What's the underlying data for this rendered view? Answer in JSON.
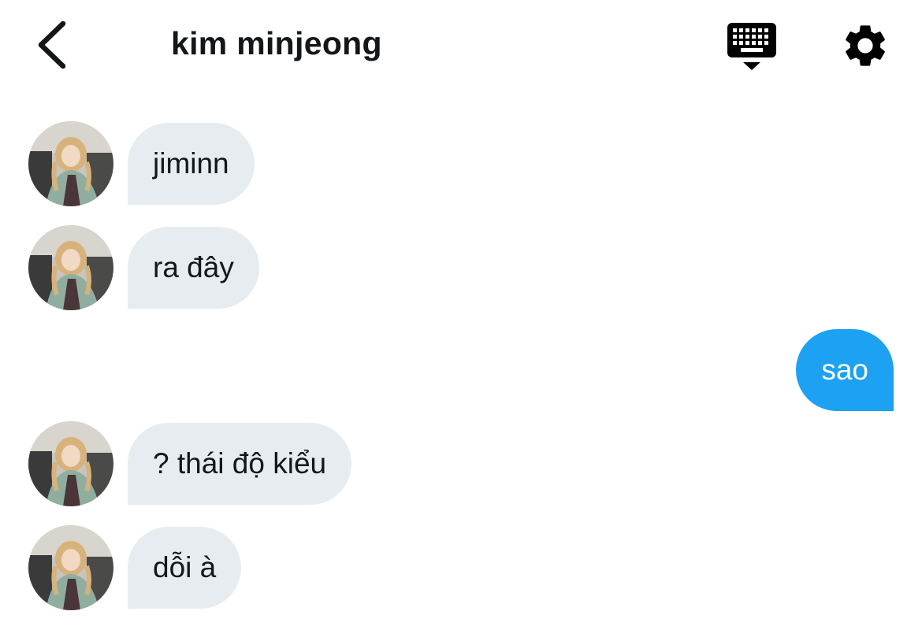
{
  "header": {
    "title": "kim minjeong",
    "back_icon": "chevron-left-icon",
    "keyboard_icon": "keyboard-hide-icon",
    "settings_icon": "gear-icon"
  },
  "messages": [
    {
      "direction": "incoming",
      "text": "jiminn"
    },
    {
      "direction": "incoming",
      "text": "ra đây"
    },
    {
      "direction": "outgoing",
      "text": "sao"
    },
    {
      "direction": "incoming",
      "text": "? thái độ kiểu"
    },
    {
      "direction": "incoming",
      "text": "dỗi à"
    }
  ],
  "colors": {
    "incoming_bubble": "#e6ecf0",
    "outgoing_bubble": "#1da1f2",
    "text": "#14171a",
    "background": "#ffffff"
  }
}
